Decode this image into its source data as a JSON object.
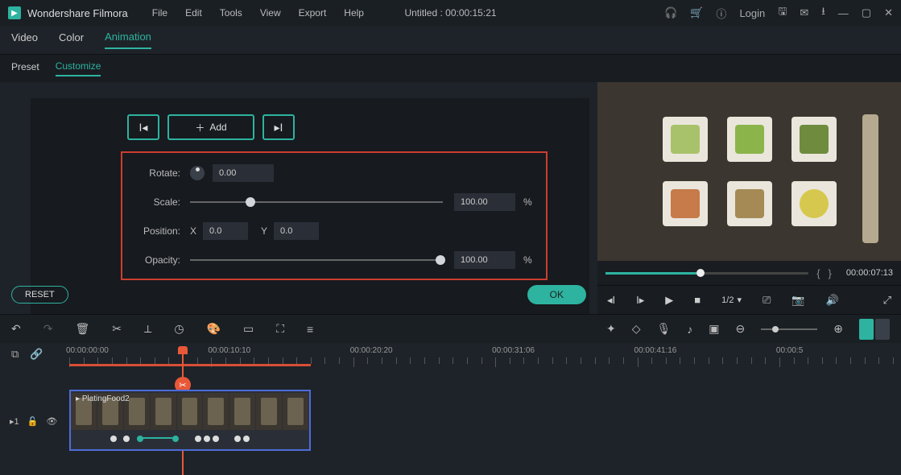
{
  "titlebar": {
    "app_name": "Wondershare Filmora",
    "menu": [
      "File",
      "Edit",
      "Tools",
      "View",
      "Export",
      "Help"
    ],
    "doc_title": "Untitled : 00:00:15:21",
    "login": "Login"
  },
  "tabs": {
    "items": [
      "Video",
      "Color",
      "Animation"
    ],
    "active": "Animation"
  },
  "subtabs": {
    "items": [
      "Preset",
      "Customize"
    ],
    "active": "Customize"
  },
  "keyframe": {
    "add_label": "Add"
  },
  "props": {
    "rotate_label": "Rotate:",
    "rotate_val": "0.00",
    "scale_label": "Scale:",
    "scale_val": "100.00",
    "scale_unit": "%",
    "position_label": "Position:",
    "pos_x_label": "X",
    "pos_x_val": "0.0",
    "pos_y_label": "Y",
    "pos_y_val": "0.0",
    "opacity_label": "Opacity:",
    "opacity_val": "100.00",
    "opacity_unit": "%"
  },
  "buttons": {
    "reset": "RESET",
    "ok": "OK"
  },
  "preview": {
    "timecode": "00:00:07:13",
    "zoom": "1/2"
  },
  "timeline": {
    "labels": [
      "00:00:00:00",
      "00:00:10:10",
      "00:00:20:20",
      "00:00:31:06",
      "00:00:41:16",
      "00:00:5"
    ],
    "track_badge": "1",
    "clip_name": "PlatingFood2"
  }
}
